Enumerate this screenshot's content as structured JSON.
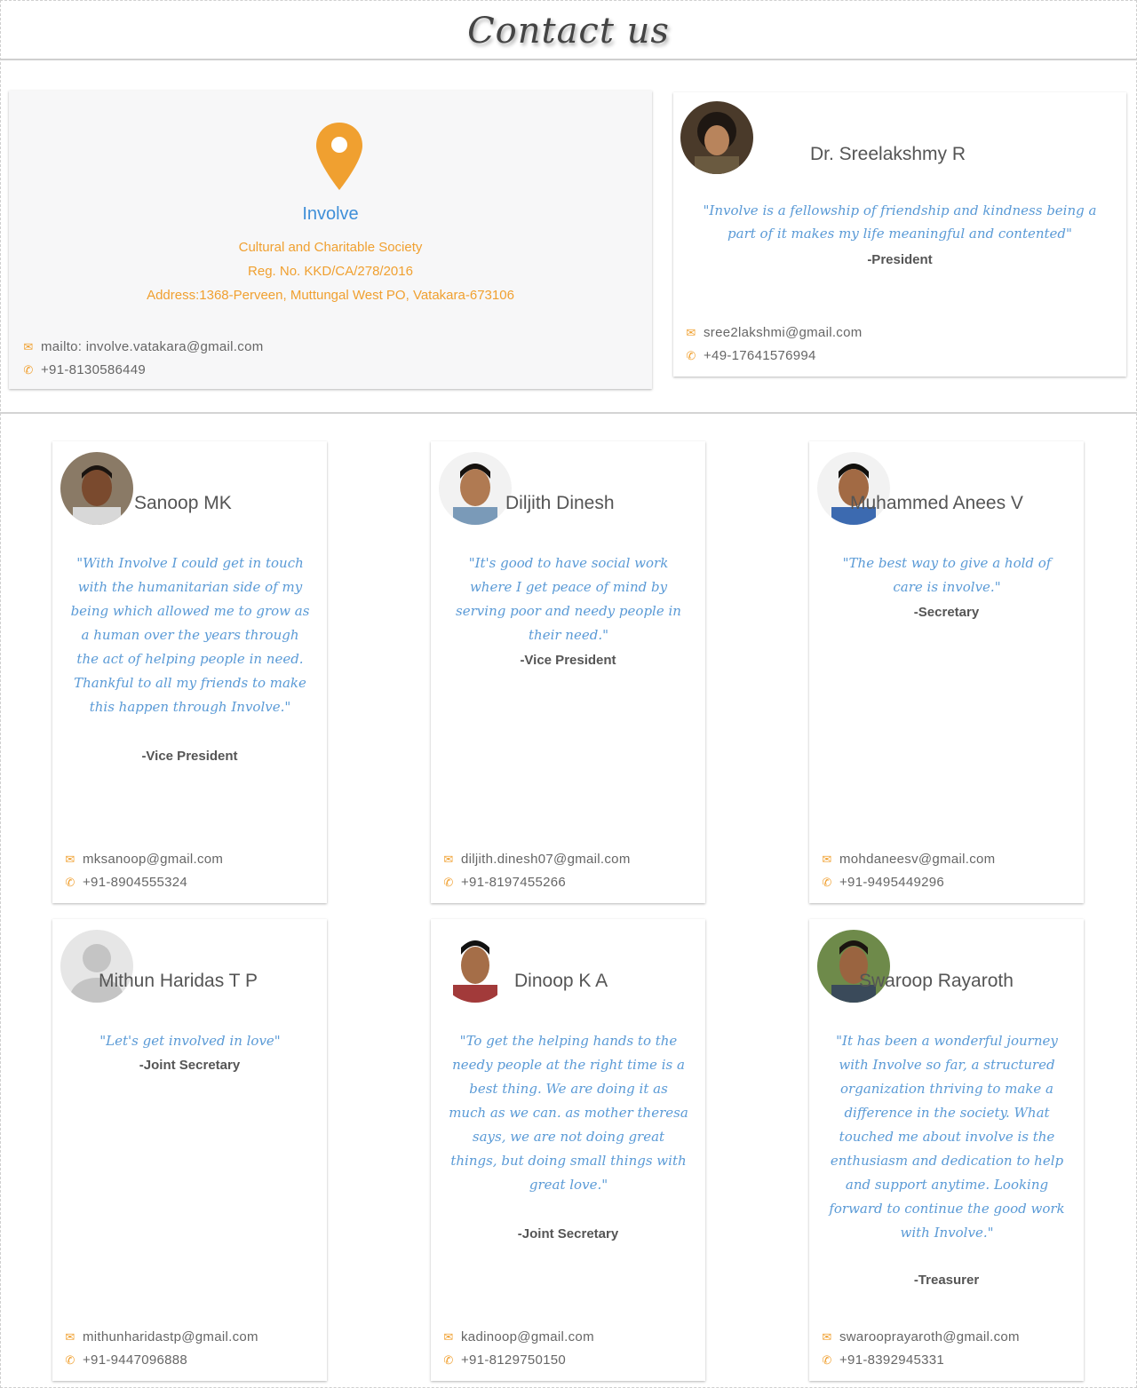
{
  "page": {
    "title": "Contact us"
  },
  "organization": {
    "name": "Involve",
    "subtitle": "Cultural and Charitable Society",
    "reg_no": "Reg. No. KKD/CA/278/2016",
    "address": "Address:1368-Perveen, Muttungal West PO, Vatakara-673106",
    "email": "mailto: involve.vatakara@gmail.com",
    "phone": "+91-8130586449",
    "icon": "map-pin-icon"
  },
  "president": {
    "name": "Dr. Sreelakshmy R",
    "quote": "\"Involve is a fellowship of friendship and kindness being a part of it makes my life meaningful and contented\"",
    "role": "-President",
    "email": "sree2lakshmi@gmail.com",
    "phone": "+49-17641576994"
  },
  "members": [
    {
      "name": "Sanoop MK",
      "quote": "\"With Involve I could get in touch with the humanitarian side of my being which allowed me to grow as a human over the years through the act of helping people in need. Thankful to all my friends to make this happen through Involve.\"",
      "role": "-Vice President",
      "email": "mksanoop@gmail.com",
      "phone": "+91-8904555324"
    },
    {
      "name": "Diljith Dinesh",
      "quote": "\"It's good to have social work where I get peace of mind by serving poor and needy people in their need.\"",
      "role": "-Vice President",
      "email": "diljith.dinesh07@gmail.com",
      "phone": "+91-8197455266"
    },
    {
      "name": "Muhammed Anees V",
      "quote": "\"The best way to give a hold of care is involve.\"",
      "role": "-Secretary",
      "email": "mohdaneesv@gmail.com",
      "phone": "+91-9495449296"
    },
    {
      "name": "Mithun Haridas T P",
      "quote": "\"Let's get involved in love\"",
      "role": "-Joint Secretary",
      "email": "mithunharidastp@gmail.com",
      "phone": "+91-9447096888"
    },
    {
      "name": "Dinoop K A",
      "quote": "\"To get the helping hands to the needy people at the right time is a best thing. We are doing it as much as we can. as mother theresa says, we are not doing great things, but doing small things with great love.\"",
      "role": "-Joint Secretary",
      "email": "kadinoop@gmail.com",
      "phone": "+91-8129750150"
    },
    {
      "name": "Swaroop Rayaroth",
      "quote": "\"It has been a wonderful journey with Involve so far, a structured organization thriving to make a difference in the society. What touched me about involve is the enthusiasm and dedication to help and support anytime. Looking forward to continue the good work with Involve.\"",
      "role": "-Treasurer",
      "email": "swarooprayaroth@gmail.com",
      "phone": "+91-8392945331"
    }
  ],
  "icons": {
    "email": "envelope-icon",
    "phone": "phone-icon"
  },
  "colors": {
    "accent": "#f0a030",
    "link": "#3f8fd8",
    "quote": "#5a9ad6"
  }
}
